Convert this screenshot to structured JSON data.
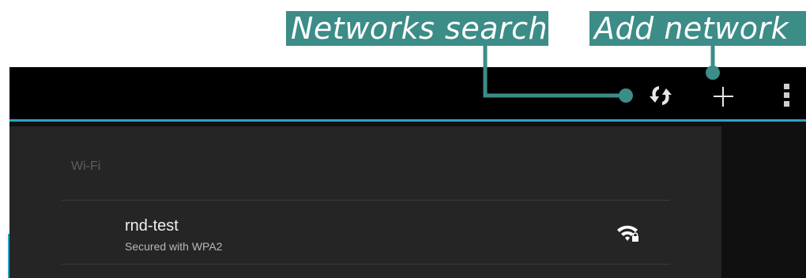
{
  "callouts": {
    "search_label": "Networks search",
    "add_label": "Add network",
    "color": "#3c8c87"
  },
  "action_bar": {
    "actions": [
      {
        "icon": "refresh-icon",
        "purpose": "search networks"
      },
      {
        "icon": "plus-icon",
        "purpose": "add network"
      },
      {
        "icon": "overflow-menu-icon",
        "purpose": "more options"
      }
    ],
    "divider_color": "#2aa3c9"
  },
  "wifi_section": {
    "title": "Wi-Fi",
    "networks": [
      {
        "name": "rnd-test",
        "status": "Secured with WPA2",
        "icon": "wifi-locked-icon"
      }
    ]
  }
}
